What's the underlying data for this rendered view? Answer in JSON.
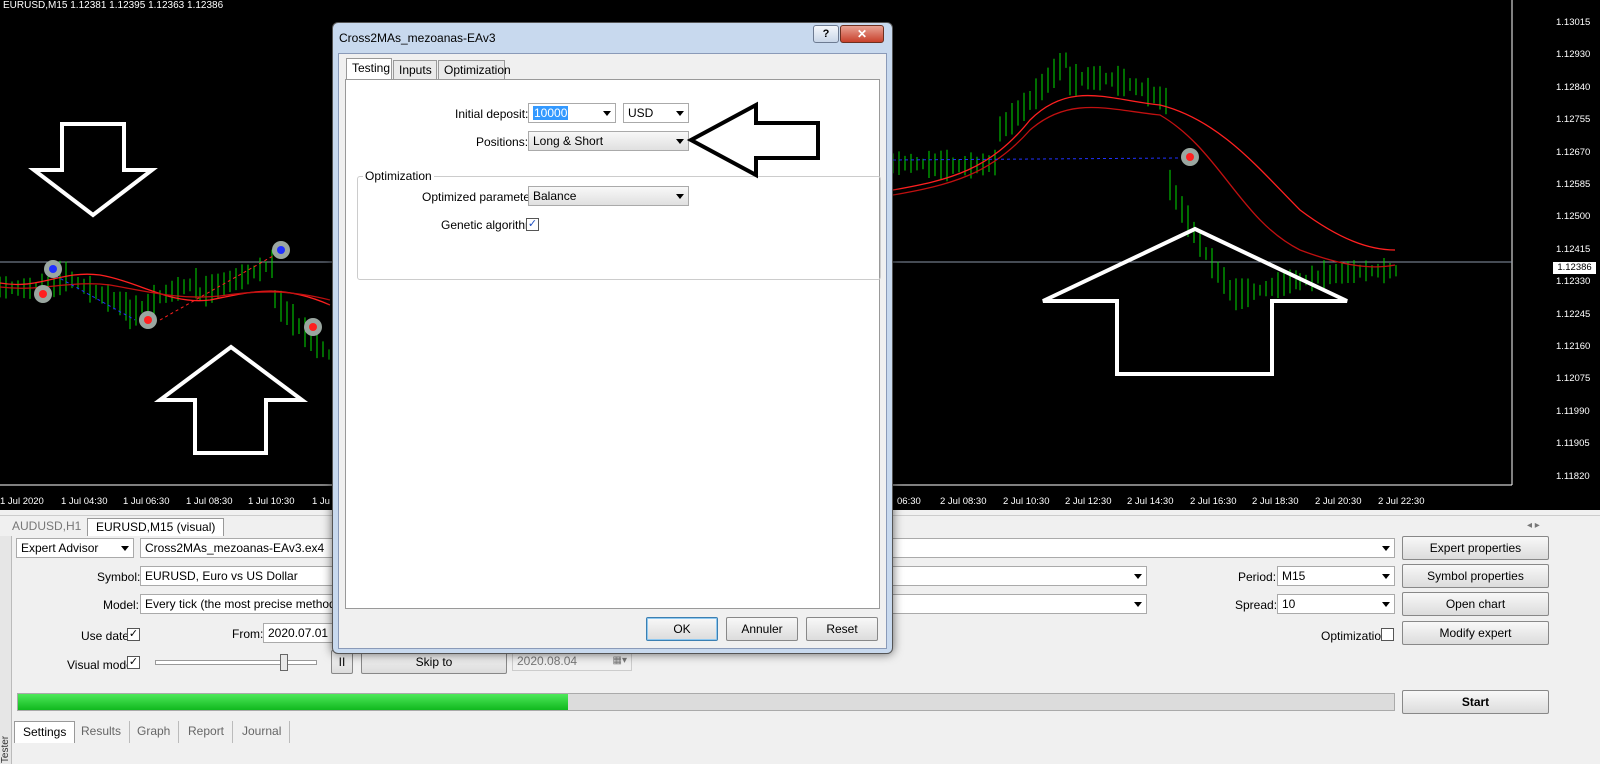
{
  "chart": {
    "title": "EURUSD,M15  1.12381 1.12395 1.12363 1.12386",
    "price_labels": [
      "1.13015",
      "1.12930",
      "1.12840",
      "1.12755",
      "1.12670",
      "1.12585",
      "1.12500",
      "1.12415",
      "1.12330",
      "1.12245",
      "1.12160",
      "1.12075",
      "1.11990",
      "1.11905",
      "1.11820"
    ],
    "current_price": "1.12386",
    "time_labels_left": [
      "1 Jul 2020",
      "1 Jul 04:30",
      "1 Jul 06:30",
      "1 Jul 08:30",
      "1 Jul 10:30",
      "1 Ju"
    ],
    "time_labels_right": [
      "06:30",
      "2 Jul 08:30",
      "2 Jul 10:30",
      "2 Jul 12:30",
      "2 Jul 14:30",
      "2 Jul 16:30",
      "2 Jul 18:30",
      "2 Jul 20:30",
      "2 Jul 22:30"
    ]
  },
  "chart_tabs": [
    "AUDUSD,H1",
    "EURUSD,M15 (visual)"
  ],
  "tester": {
    "side_label": "Tester",
    "type_value": "Expert Advisor",
    "expert_file": "Cross2MAs_mezoanas-EAv3.ex4",
    "symbol_label": "Symbol:",
    "symbol_value": "EURUSD, Euro vs US Dollar",
    "model_label": "Model:",
    "model_value": "Every tick (the most precise method bas",
    "use_date_label": "Use date",
    "use_date_check": "✓",
    "from_label": "From:",
    "from_value": "2020.07.01",
    "visual_mode_label": "Visual mode",
    "visual_mode_check": "✓",
    "pause_label": "II",
    "skip_to_label": "Skip to",
    "skip_to_date": "2020.08.04",
    "period_label": "Period:",
    "period_value": "M15",
    "spread_label": "Spread:",
    "spread_value": "10",
    "optimization_label": "Optimization",
    "buttons": {
      "expert_properties": "Expert properties",
      "symbol_properties": "Symbol properties",
      "open_chart": "Open chart",
      "modify_expert": "Modify expert",
      "start": "Start"
    },
    "progress": 0.4,
    "bottom_tabs": [
      "Settings",
      "Results",
      "Graph",
      "Report",
      "Journal"
    ]
  },
  "dialog": {
    "title": "Cross2MAs_mezoanas-EAv3",
    "help": "?",
    "close": "✕",
    "tabs": [
      "Testing",
      "Inputs",
      "Optimization"
    ],
    "initial_deposit_label": "Initial deposit:",
    "initial_deposit_value": "10000",
    "currency_value": "USD",
    "positions_label": "Positions:",
    "positions_value": "Long & Short",
    "optimization_group": "Optimization",
    "optimized_parameter_label": "Optimized parameter:",
    "optimized_parameter_value": "Balance",
    "genetic_label": "Genetic algorithm",
    "genetic_check": "✓",
    "ok": "OK",
    "cancel": "Annuler",
    "reset": "Reset"
  },
  "colors": {
    "chart_bg": "#000000",
    "candle": "#00dd00",
    "ma_red": "#ff2020",
    "progress_green": "#10c020"
  }
}
